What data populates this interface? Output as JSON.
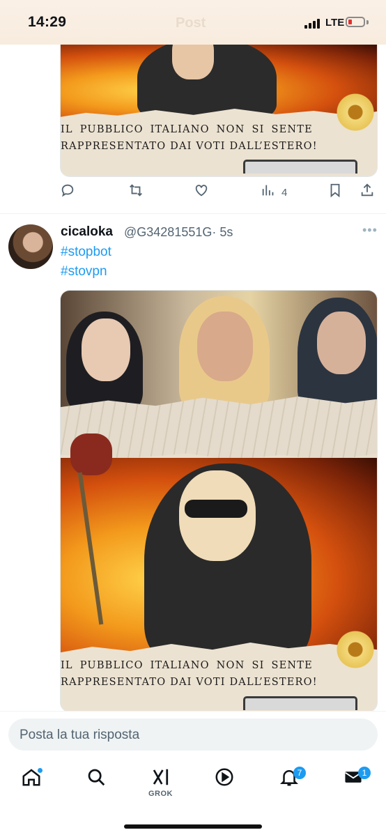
{
  "status_bar": {
    "time": "14:29",
    "faded_header_title": "Post",
    "network": "LTE",
    "battery_color": "#e0322d"
  },
  "tweet_previous": {
    "image_caption_line1": [
      "IL",
      "PUBBLICO",
      "ITALIANO",
      "NON",
      "SI",
      "SENTE"
    ],
    "image_caption_line2": "RAPPRESENTATO DAI VOTI DALL’ESTERO!",
    "actions": {
      "reply_icon": "reply-icon",
      "retweet_icon": "retweet-icon",
      "like_icon": "heart-icon",
      "views_icon": "views-icon",
      "views_count": "4",
      "bookmark_icon": "bookmark-icon",
      "share_icon": "share-icon"
    }
  },
  "tweet": {
    "display_name": "cicaloka",
    "handle": "@G34281551G",
    "separator": "·",
    "time_ago": "5s",
    "more_icon": "more-icon",
    "hashtags": [
      "#stopbot",
      "#stovpn"
    ],
    "image_caption_line1": [
      "IL",
      "PUBBLICO",
      "ITALIANO",
      "NON",
      "SI",
      "SENTE"
    ],
    "image_caption_line2": "RAPPRESENTATO DAI VOTI DALL’ESTERO!"
  },
  "reply_bar": {
    "placeholder": "Posta la tua risposta"
  },
  "bottom_nav": {
    "items": [
      {
        "icon": "home-icon",
        "has_dot": true
      },
      {
        "icon": "search-icon"
      },
      {
        "icon": "grok-icon",
        "label": "GROK"
      },
      {
        "icon": "video-icon"
      },
      {
        "icon": "bell-icon",
        "badge": "7"
      },
      {
        "icon": "mail-icon",
        "badge": "1"
      }
    ]
  },
  "accent_color": "#1d9bf0"
}
